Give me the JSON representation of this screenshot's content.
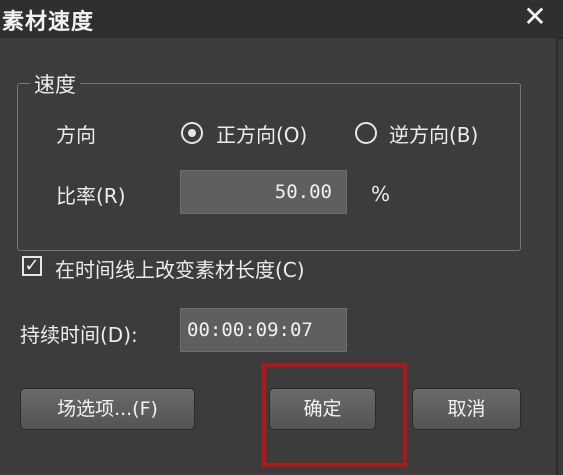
{
  "window": {
    "title": "素材速度",
    "close_glyph": "✕"
  },
  "speed_group": {
    "legend": "速度",
    "direction_label": "方向",
    "forward_label": "正方向(O)",
    "reverse_label": "逆方向(B)",
    "selected_direction": "forward",
    "rate_label": "比率(R)",
    "rate_value": "50.00",
    "rate_unit": "%"
  },
  "timeline_option": {
    "checked": true,
    "check_glyph": "✓",
    "label": "在时间线上改变素材长度(C)"
  },
  "duration": {
    "label": "持续时间(D):",
    "value": "00:00:09:07"
  },
  "buttons": {
    "field_options": "场选项...(F)",
    "ok": "确定",
    "cancel": "取消"
  },
  "colors": {
    "highlight_box": "#b01818",
    "dialog_bg": "#3c3c3c"
  }
}
